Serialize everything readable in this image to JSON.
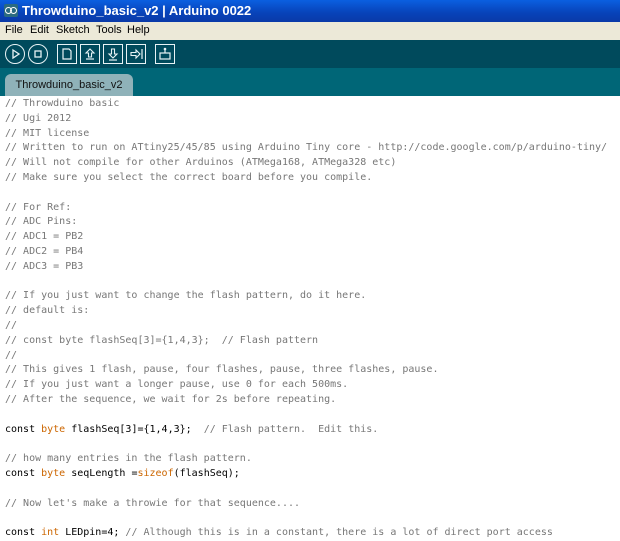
{
  "window": {
    "title": "Throwduino_basic_v2 | Arduino 0022"
  },
  "menu": [
    {
      "id": "file",
      "label": "File"
    },
    {
      "id": "edit",
      "label": "Edit"
    },
    {
      "id": "sketch",
      "label": "Sketch"
    },
    {
      "id": "tools",
      "label": "Tools"
    },
    {
      "id": "help",
      "label": "Help"
    }
  ],
  "toolbar": [
    {
      "id": "verify",
      "icon": "play-icon"
    },
    {
      "id": "stop",
      "icon": "stop-icon"
    },
    {
      "id": "new",
      "icon": "new-file-icon"
    },
    {
      "id": "open",
      "icon": "open-arrow-up-icon"
    },
    {
      "id": "save",
      "icon": "save-arrow-down-icon"
    },
    {
      "id": "upload",
      "icon": "upload-arrow-right-icon"
    },
    {
      "id": "serial-monitor",
      "icon": "serial-monitor-icon"
    }
  ],
  "tabs": [
    {
      "label": "Throwduino_basic_v2",
      "active": true
    }
  ],
  "colors": {
    "titlebar": "#0842b8",
    "toolbar": "#004a5c",
    "tabbar": "#006677",
    "tab_active": "#8fb2b9",
    "comment": "#777777",
    "keyword": "#cc6600"
  },
  "code_lines": [
    {
      "kind": "comment",
      "segs": [
        {
          "t": "// Throwduino basic",
          "c": "comment"
        }
      ]
    },
    {
      "kind": "comment",
      "segs": [
        {
          "t": "// Ugi 2012",
          "c": "comment"
        }
      ]
    },
    {
      "kind": "comment",
      "segs": [
        {
          "t": "// MIT license",
          "c": "comment"
        }
      ]
    },
    {
      "kind": "comment",
      "segs": [
        {
          "t": "// Written to run on ATtiny25/45/85 using Arduino Tiny core - http://code.google.com/p/arduino-tiny/",
          "c": "comment"
        }
      ]
    },
    {
      "kind": "comment",
      "segs": [
        {
          "t": "// Will not compile for other Arduinos (ATMega168, ATMega328 etc)",
          "c": "comment"
        }
      ]
    },
    {
      "kind": "comment",
      "segs": [
        {
          "t": "// Make sure you select the correct board before you compile.",
          "c": "comment"
        }
      ]
    },
    {
      "kind": "blank",
      "segs": []
    },
    {
      "kind": "comment",
      "segs": [
        {
          "t": "// For Ref:",
          "c": "comment"
        }
      ]
    },
    {
      "kind": "comment",
      "segs": [
        {
          "t": "// ADC Pins:",
          "c": "comment"
        }
      ]
    },
    {
      "kind": "comment",
      "segs": [
        {
          "t": "// ADC1 = PB2",
          "c": "comment"
        }
      ]
    },
    {
      "kind": "comment",
      "segs": [
        {
          "t": "// ADC2 = PB4",
          "c": "comment"
        }
      ]
    },
    {
      "kind": "comment",
      "segs": [
        {
          "t": "// ADC3 = PB3",
          "c": "comment"
        }
      ]
    },
    {
      "kind": "blank",
      "segs": []
    },
    {
      "kind": "comment",
      "segs": [
        {
          "t": "// If you just want to change the flash pattern, do it here.",
          "c": "comment"
        }
      ]
    },
    {
      "kind": "comment",
      "segs": [
        {
          "t": "// default is:",
          "c": "comment"
        }
      ]
    },
    {
      "kind": "comment",
      "segs": [
        {
          "t": "//",
          "c": "comment"
        }
      ]
    },
    {
      "kind": "comment",
      "segs": [
        {
          "t": "// const byte flashSeq[3]={1,4,3};  // Flash pattern",
          "c": "comment"
        }
      ]
    },
    {
      "kind": "comment",
      "segs": [
        {
          "t": "//",
          "c": "comment"
        }
      ]
    },
    {
      "kind": "comment",
      "segs": [
        {
          "t": "// This gives 1 flash, pause, four flashes, pause, three flashes, pause.",
          "c": "comment"
        }
      ]
    },
    {
      "kind": "comment",
      "segs": [
        {
          "t": "// If you just want a longer pause, use 0 for each 500ms.",
          "c": "comment"
        }
      ]
    },
    {
      "kind": "comment",
      "segs": [
        {
          "t": "// After the sequence, we wait for 2s before repeating.",
          "c": "comment"
        }
      ]
    },
    {
      "kind": "blank",
      "segs": []
    },
    {
      "kind": "code",
      "segs": [
        {
          "t": "const ",
          "c": "code"
        },
        {
          "t": "byte",
          "c": "kw"
        },
        {
          "t": " flashSeq[3]={1,4,3};  ",
          "c": "code"
        },
        {
          "t": "// Flash pattern.  Edit this.",
          "c": "comment"
        }
      ]
    },
    {
      "kind": "blank",
      "segs": []
    },
    {
      "kind": "comment",
      "segs": [
        {
          "t": "// how many entries in the flash pattern.",
          "c": "comment"
        }
      ]
    },
    {
      "kind": "code",
      "segs": [
        {
          "t": "const ",
          "c": "code"
        },
        {
          "t": "byte",
          "c": "kw"
        },
        {
          "t": " seqLength =",
          "c": "code"
        },
        {
          "t": "sizeof",
          "c": "kw"
        },
        {
          "t": "(flashSeq);",
          "c": "code"
        }
      ]
    },
    {
      "kind": "blank",
      "segs": []
    },
    {
      "kind": "comment",
      "segs": [
        {
          "t": "// Now let's make a throwie for that sequence....",
          "c": "comment"
        }
      ]
    },
    {
      "kind": "blank",
      "segs": []
    },
    {
      "kind": "code",
      "segs": [
        {
          "t": "const ",
          "c": "code"
        },
        {
          "t": "int",
          "c": "kw"
        },
        {
          "t": " LEDpin=4; ",
          "c": "code"
        },
        {
          "t": "// Although this is in a constant, there is a lot of direct port access",
          "c": "comment"
        }
      ]
    }
  ]
}
